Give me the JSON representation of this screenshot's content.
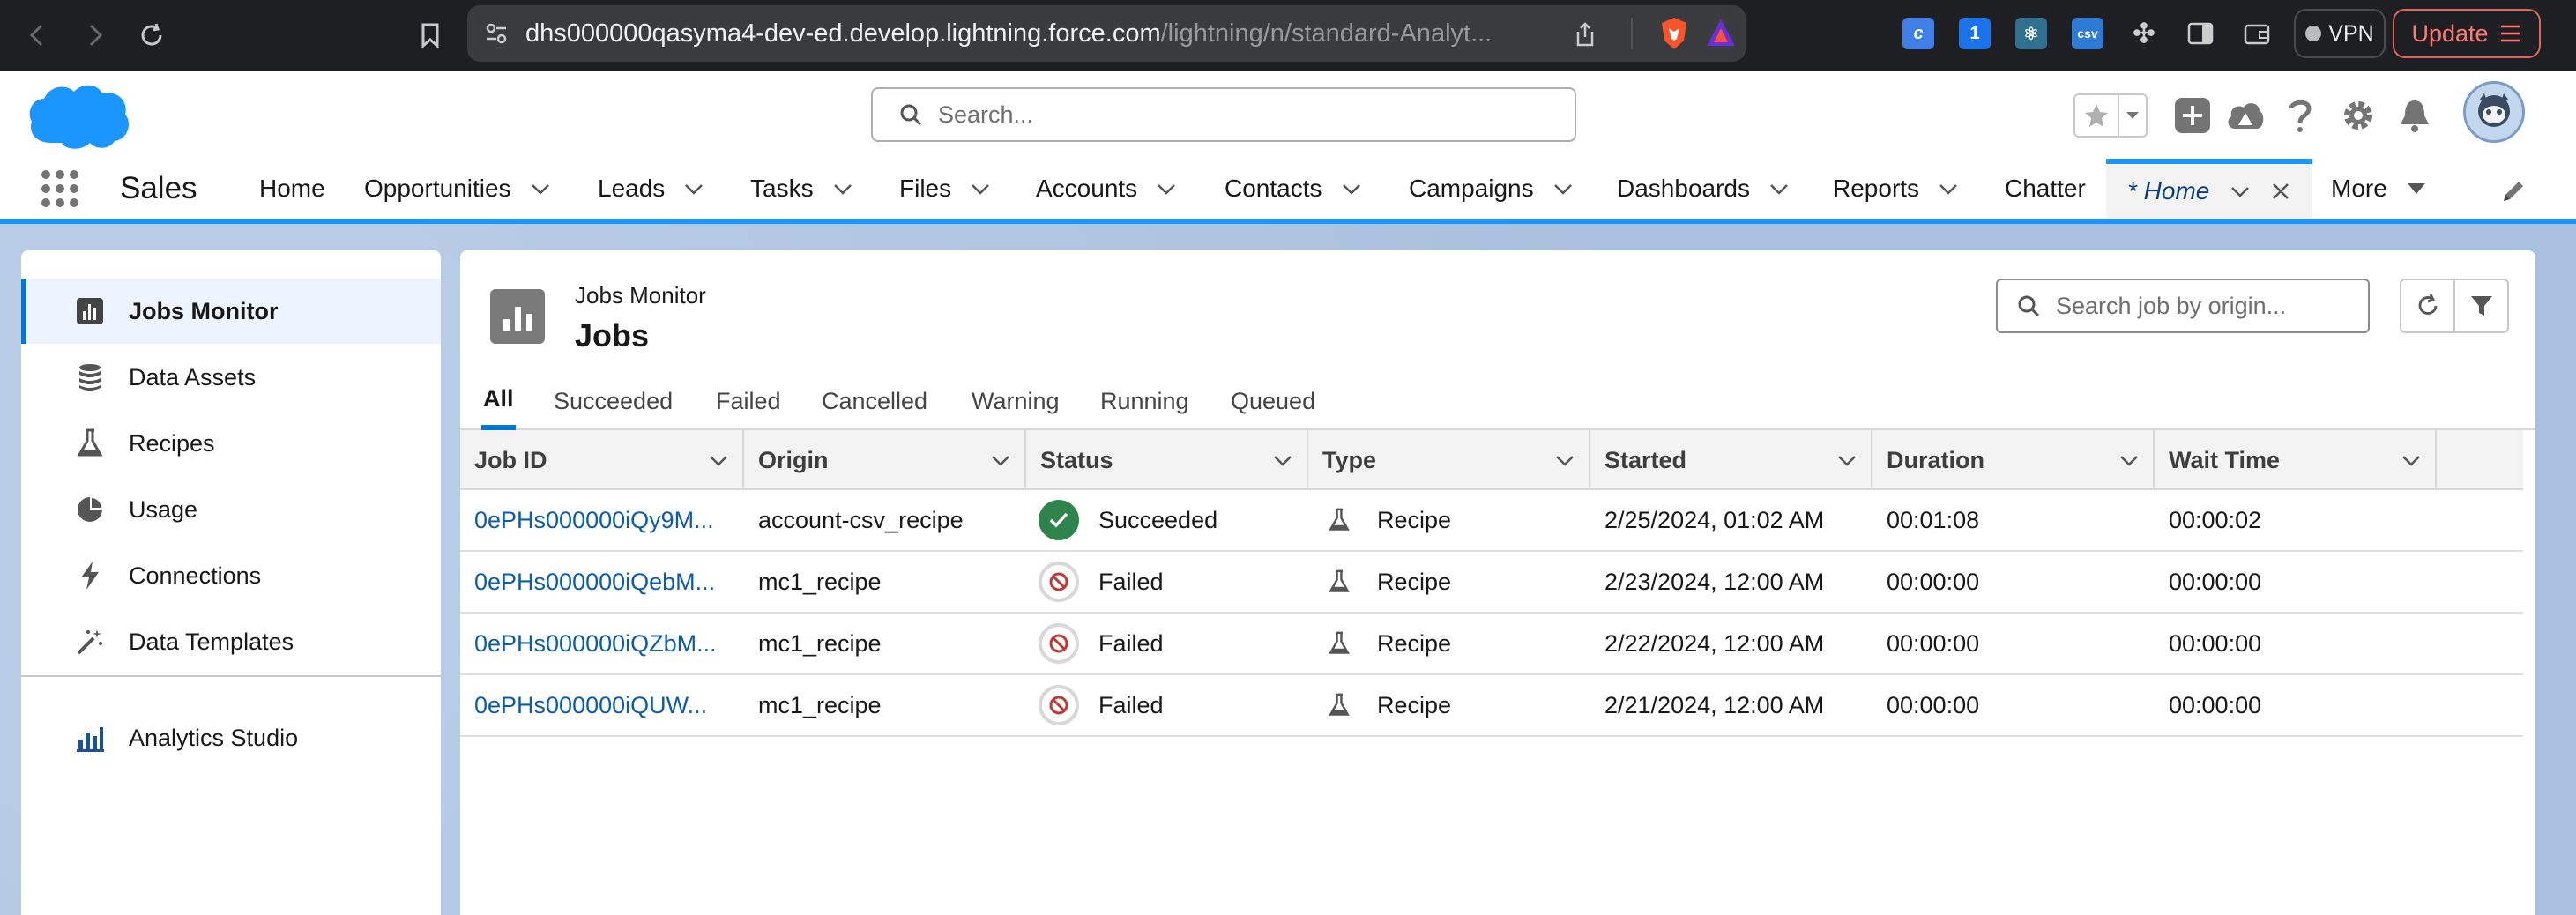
{
  "browser": {
    "url_host": "dhs000000qasyma4-dev-ed.develop.lightning.force.com",
    "url_path": "/lightning/n/standard-Analyt...",
    "vpn_label": "VPN",
    "update_label": "Update"
  },
  "header": {
    "search_placeholder": "Search..."
  },
  "nav": {
    "app_name": "Sales",
    "items": [
      {
        "label": "Home"
      },
      {
        "label": "Opportunities"
      },
      {
        "label": "Leads"
      },
      {
        "label": "Tasks"
      },
      {
        "label": "Files"
      },
      {
        "label": "Accounts"
      },
      {
        "label": "Contacts"
      },
      {
        "label": "Campaigns"
      },
      {
        "label": "Dashboards"
      },
      {
        "label": "Reports"
      },
      {
        "label": "Chatter"
      }
    ],
    "active_tab": "* Home",
    "more_label": "More"
  },
  "sidebar": {
    "items": [
      {
        "label": "Jobs Monitor"
      },
      {
        "label": "Data Assets"
      },
      {
        "label": "Recipes"
      },
      {
        "label": "Usage"
      },
      {
        "label": "Connections"
      },
      {
        "label": "Data Templates"
      },
      {
        "label": "Analytics Studio"
      }
    ]
  },
  "page": {
    "breadcrumb": "Jobs Monitor",
    "title": "Jobs",
    "search_placeholder": "Search job by origin...",
    "tabs": [
      "All",
      "Succeeded",
      "Failed",
      "Cancelled",
      "Warning",
      "Running",
      "Queued"
    ]
  },
  "table": {
    "columns": [
      "Job ID",
      "Origin",
      "Status",
      "Type",
      "Started",
      "Duration",
      "Wait Time"
    ],
    "rows": [
      {
        "job_id": "0ePHs000000iQy9M...",
        "origin": "account-csv_recipe",
        "status": "Succeeded",
        "type": "Recipe",
        "started": "2/25/2024, 01:02 AM",
        "duration": "00:01:08",
        "wait": "00:00:02"
      },
      {
        "job_id": "0ePHs000000iQebM...",
        "origin": "mc1_recipe",
        "status": "Failed",
        "type": "Recipe",
        "started": "2/23/2024, 12:00 AM",
        "duration": "00:00:00",
        "wait": "00:00:00"
      },
      {
        "job_id": "0ePHs000000iQZbM...",
        "origin": "mc1_recipe",
        "status": "Failed",
        "type": "Recipe",
        "started": "2/22/2024, 12:00 AM",
        "duration": "00:00:00",
        "wait": "00:00:00"
      },
      {
        "job_id": "0ePHs000000iQUW...",
        "origin": "mc1_recipe",
        "status": "Failed",
        "type": "Recipe",
        "started": "2/21/2024, 12:00 AM",
        "duration": "00:00:00",
        "wait": "00:00:00"
      }
    ]
  },
  "colors": {
    "accent": "#0176d3",
    "link": "#0b5cab",
    "success": "#2e844a",
    "error": "#c23934",
    "cloud": "#1b96ff"
  }
}
